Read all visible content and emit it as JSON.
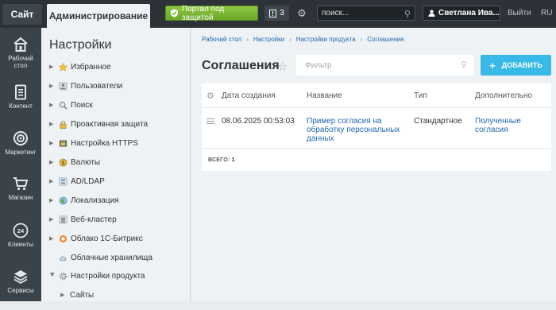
{
  "topbar": {
    "site_tab": "Сайт",
    "admin_tab": "Администрирование",
    "portal_button": "Портал под защитой",
    "notifications_count": "3",
    "search_placeholder": "поиск...",
    "user_name": "Светлана Ива...",
    "logout": "Выйти",
    "language": "RU"
  },
  "leftnav": {
    "items": [
      {
        "label1": "Рабочий",
        "label2": "стол",
        "icon": "home-icon"
      },
      {
        "label1": "Контент",
        "label2": "",
        "icon": "document-icon"
      },
      {
        "label1": "Маркетинг",
        "label2": "",
        "icon": "target-icon"
      },
      {
        "label1": "Магазин",
        "label2": "",
        "icon": "cart-icon"
      },
      {
        "label1": "Клиенты",
        "label2": "",
        "icon": "clients-24-icon"
      },
      {
        "label1": "Сервисы",
        "label2": "",
        "icon": "layers-icon"
      }
    ]
  },
  "settings": {
    "title": "Настройки",
    "items": [
      {
        "label": "Избранное",
        "icon": "star-icon"
      },
      {
        "label": "Пользователи",
        "icon": "users-icon"
      },
      {
        "label": "Поиск",
        "icon": "search-icon"
      },
      {
        "label": "Проактивная защита",
        "icon": "lock-icon"
      },
      {
        "label": "Настройка HTTPS",
        "icon": "https-icon"
      },
      {
        "label": "Валюты",
        "icon": "currency-icon"
      },
      {
        "label": "AD/LDAP",
        "icon": "ldap-icon"
      },
      {
        "label": "Локализация",
        "icon": "globe-icon"
      },
      {
        "label": "Веб-кластер",
        "icon": "cluster-icon"
      },
      {
        "label": "Облако 1С-Битрикс",
        "icon": "cloud-icon"
      },
      {
        "label": "Облачные хранилища",
        "icon": "cloud-storage-icon"
      },
      {
        "label": "Настройки продукта",
        "icon": "gear-icon"
      },
      {
        "label": "Сайты",
        "icon": ""
      }
    ]
  },
  "main": {
    "breadcrumb": [
      "Рабочий стол",
      "Настройки",
      "Настройки продукта",
      "Соглашения"
    ],
    "title": "Соглашения",
    "filter_placeholder": "Фильтр",
    "add_button": "ДОБАВИТЬ",
    "columns": [
      "Дата создания",
      "Название",
      "Тип",
      "Дополнительно"
    ],
    "rows": [
      {
        "date": "08.06.2025 00:53:03",
        "name_line1": "Пример согласия на",
        "name_line2": "обработку персональных",
        "name_line3": "данных",
        "type": "Стандартное",
        "extra_line1": "Полученные",
        "extra_line2": "согласия"
      }
    ],
    "total_label": "ВСЕГО:",
    "total_value": "1"
  }
}
